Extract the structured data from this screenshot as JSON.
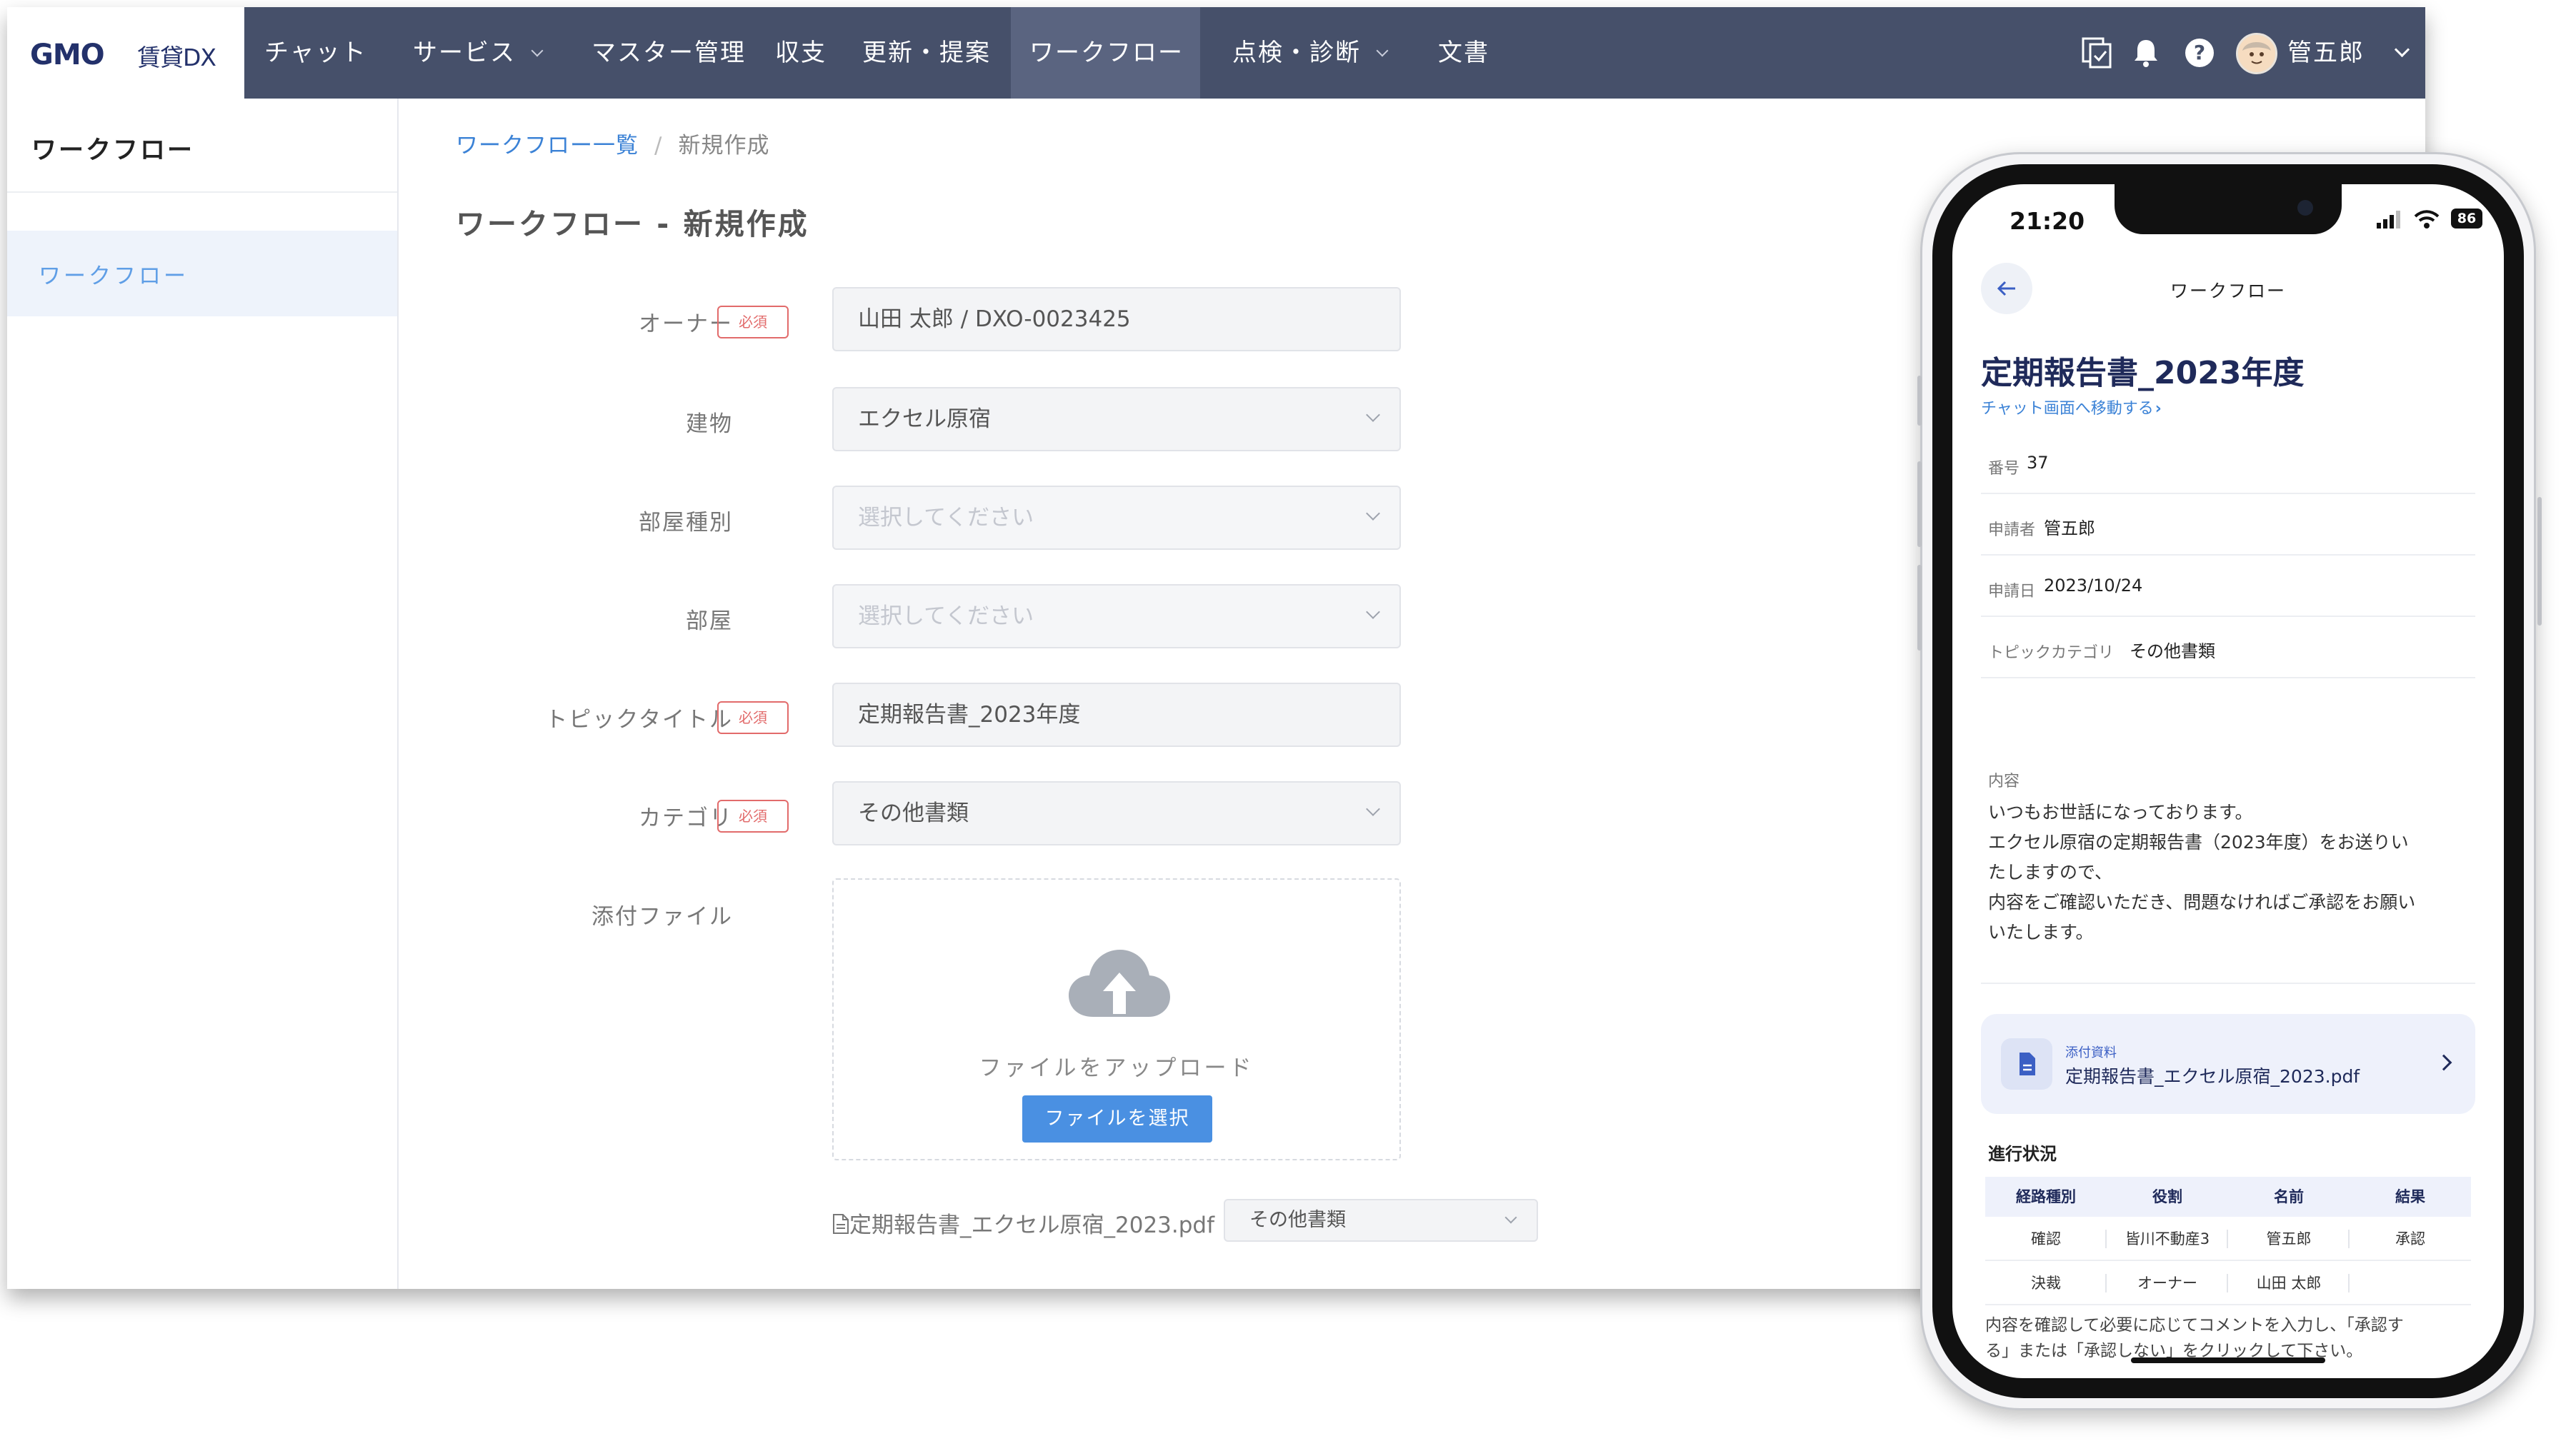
{
  "desktop": {
    "logo": {
      "mark": "GMO",
      "sub": "賃貸DX"
    },
    "nav": [
      {
        "label": "チャット",
        "dropdown": false
      },
      {
        "label": "サービス",
        "dropdown": true
      },
      {
        "label": "マスター管理",
        "dropdown": false
      },
      {
        "label": "収支",
        "dropdown": false
      },
      {
        "label": "更新・提案",
        "dropdown": false
      },
      {
        "label": "ワークフロー",
        "dropdown": false,
        "active": true
      },
      {
        "label": "点検・診断",
        "dropdown": true
      },
      {
        "label": "文書",
        "dropdown": false
      }
    ],
    "header_icons": [
      "tasks-icon",
      "bell-icon",
      "help-icon"
    ],
    "user": {
      "name": "管五郎"
    },
    "sidebar": {
      "title": "ワークフロー",
      "items": [
        "ワークフロー"
      ]
    },
    "breadcrumb": {
      "link": "ワークフロー一覧",
      "separator": "/",
      "current": "新規作成"
    },
    "page_title": "ワークフロー - 新規作成",
    "required_label": "必須",
    "form": {
      "owner": {
        "label": "オーナー",
        "value": "山田 太郎 / DXO-0023425"
      },
      "building": {
        "label": "建物",
        "value": "エクセル原宿"
      },
      "room_type": {
        "label": "部屋種別",
        "placeholder": "選択してください"
      },
      "room": {
        "label": "部屋",
        "placeholder": "選択してください"
      },
      "topic_title": {
        "label": "トピックタイトル",
        "value": "定期報告書_2023年度"
      },
      "category": {
        "label": "カテゴリ",
        "value": "その他書類"
      },
      "attachment": {
        "label": "添付ファイル",
        "upload_text": "ファイルをアップロード",
        "button_label": "ファイルを選択",
        "file_name": "定期報告書_エクセル原宿_2023.pdf",
        "file_category": "その他書類"
      }
    },
    "colors": {
      "nav_bg": "#46506a",
      "accent": "#4a90e2",
      "required": "#e26b6b"
    }
  },
  "phone": {
    "status": {
      "time": "21:20",
      "battery": "86"
    },
    "header_title": "ワークフロー",
    "doc_title": "定期報告書_2023年度",
    "chat_link": "チャット画面へ移動する",
    "info": [
      {
        "key": "番号",
        "value": "37"
      },
      {
        "key": "申請者",
        "value": "管五郎"
      },
      {
        "key": "申請日",
        "value": "2023/10/24"
      },
      {
        "key": "トピックカテゴリ",
        "value": "その他書類"
      }
    ],
    "content_label": "内容",
    "content_lines": [
      "いつもお世話になっております。",
      "エクセル原宿の定期報告書（2023年度）をお送りい",
      "たしますので、",
      "内容をご確認いただき、問題なければご承認をお願い",
      "いたします。"
    ],
    "attachment": {
      "label": "添付資料",
      "name": "定期報告書_エクセル原宿_2023.pdf"
    },
    "progress_label": "進行状況",
    "progress_table": {
      "headers": [
        "経路種別",
        "役割",
        "名前",
        "結果"
      ],
      "rows": [
        [
          "確認",
          "皆川不動産3",
          "管五郎",
          "承認"
        ],
        [
          "決裁",
          "オーナー",
          "山田 太郎",
          ""
        ]
      ]
    },
    "note_lines": [
      "内容を確認して必要に応じてコメントを入力し、「承認す",
      "る」または「承認しない」をクリックして下さい。"
    ]
  }
}
